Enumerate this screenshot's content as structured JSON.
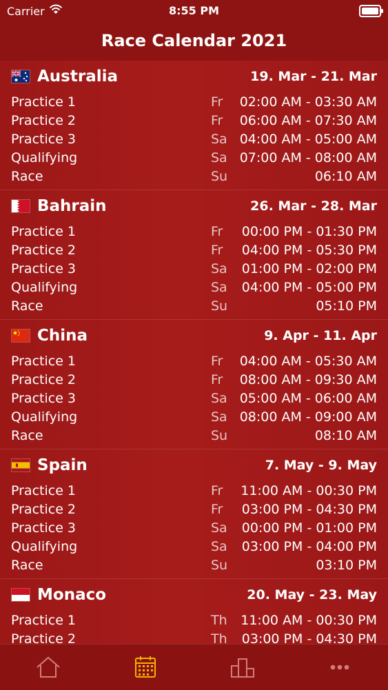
{
  "status_bar": {
    "carrier": "Carrier",
    "time": "8:55 PM",
    "wifi_icon": "wifi-icon",
    "battery_icon": "battery-icon"
  },
  "nav": {
    "title": "Race Calendar 2021"
  },
  "races": [
    {
      "country": "Australia",
      "flag": "australia-flag-icon",
      "dates": "19. Mar - 21. Mar",
      "sessions": [
        {
          "name": "Practice 1",
          "day": "Fr",
          "time": "02:00 AM - 03:30 AM"
        },
        {
          "name": "Practice 2",
          "day": "Fr",
          "time": "06:00 AM - 07:30 AM"
        },
        {
          "name": "Practice 3",
          "day": "Sa",
          "time": "04:00 AM - 05:00 AM"
        },
        {
          "name": "Qualifying",
          "day": "Sa",
          "time": "07:00 AM - 08:00 AM"
        },
        {
          "name": "Race",
          "day": "Su",
          "time": "06:10 AM"
        }
      ]
    },
    {
      "country": "Bahrain",
      "flag": "bahrain-flag-icon",
      "dates": "26. Mar - 28. Mar",
      "sessions": [
        {
          "name": "Practice 1",
          "day": "Fr",
          "time": "00:00 PM - 01:30 PM"
        },
        {
          "name": "Practice 2",
          "day": "Fr",
          "time": "04:00 PM - 05:30 PM"
        },
        {
          "name": "Practice 3",
          "day": "Sa",
          "time": "01:00 PM - 02:00 PM"
        },
        {
          "name": "Qualifying",
          "day": "Sa",
          "time": "04:00 PM - 05:00 PM"
        },
        {
          "name": "Race",
          "day": "Su",
          "time": "05:10 PM"
        }
      ]
    },
    {
      "country": "China",
      "flag": "china-flag-icon",
      "dates": "9. Apr - 11. Apr",
      "sessions": [
        {
          "name": "Practice 1",
          "day": "Fr",
          "time": "04:00 AM - 05:30 AM"
        },
        {
          "name": "Practice 2",
          "day": "Fr",
          "time": "08:00 AM - 09:30 AM"
        },
        {
          "name": "Practice 3",
          "day": "Sa",
          "time": "05:00 AM - 06:00 AM"
        },
        {
          "name": "Qualifying",
          "day": "Sa",
          "time": "08:00 AM - 09:00 AM"
        },
        {
          "name": "Race",
          "day": "Su",
          "time": "08:10 AM"
        }
      ]
    },
    {
      "country": "Spain",
      "flag": "spain-flag-icon",
      "dates": "7. May - 9. May",
      "sessions": [
        {
          "name": "Practice 1",
          "day": "Fr",
          "time": "11:00 AM - 00:30 PM"
        },
        {
          "name": "Practice 2",
          "day": "Fr",
          "time": "03:00 PM - 04:30 PM"
        },
        {
          "name": "Practice 3",
          "day": "Sa",
          "time": "00:00 PM - 01:00 PM"
        },
        {
          "name": "Qualifying",
          "day": "Sa",
          "time": "03:00 PM - 04:00 PM"
        },
        {
          "name": "Race",
          "day": "Su",
          "time": "03:10 PM"
        }
      ]
    },
    {
      "country": "Monaco",
      "flag": "monaco-flag-icon",
      "dates": "20. May - 23. May",
      "sessions": [
        {
          "name": "Practice 1",
          "day": "Th",
          "time": "11:00 AM - 00:30 PM"
        },
        {
          "name": "Practice 2",
          "day": "Th",
          "time": "03:00 PM - 04:30 PM"
        }
      ]
    }
  ],
  "tabbar": {
    "tabs": [
      {
        "name": "home",
        "icon": "home-icon",
        "active": false
      },
      {
        "name": "calendar",
        "icon": "calendar-icon",
        "active": true
      },
      {
        "name": "standings",
        "icon": "podium-icon",
        "active": false
      },
      {
        "name": "more",
        "icon": "more-icon",
        "active": false
      }
    ],
    "active_color": "#f1b500",
    "inactive_color": "#d37d7b"
  }
}
